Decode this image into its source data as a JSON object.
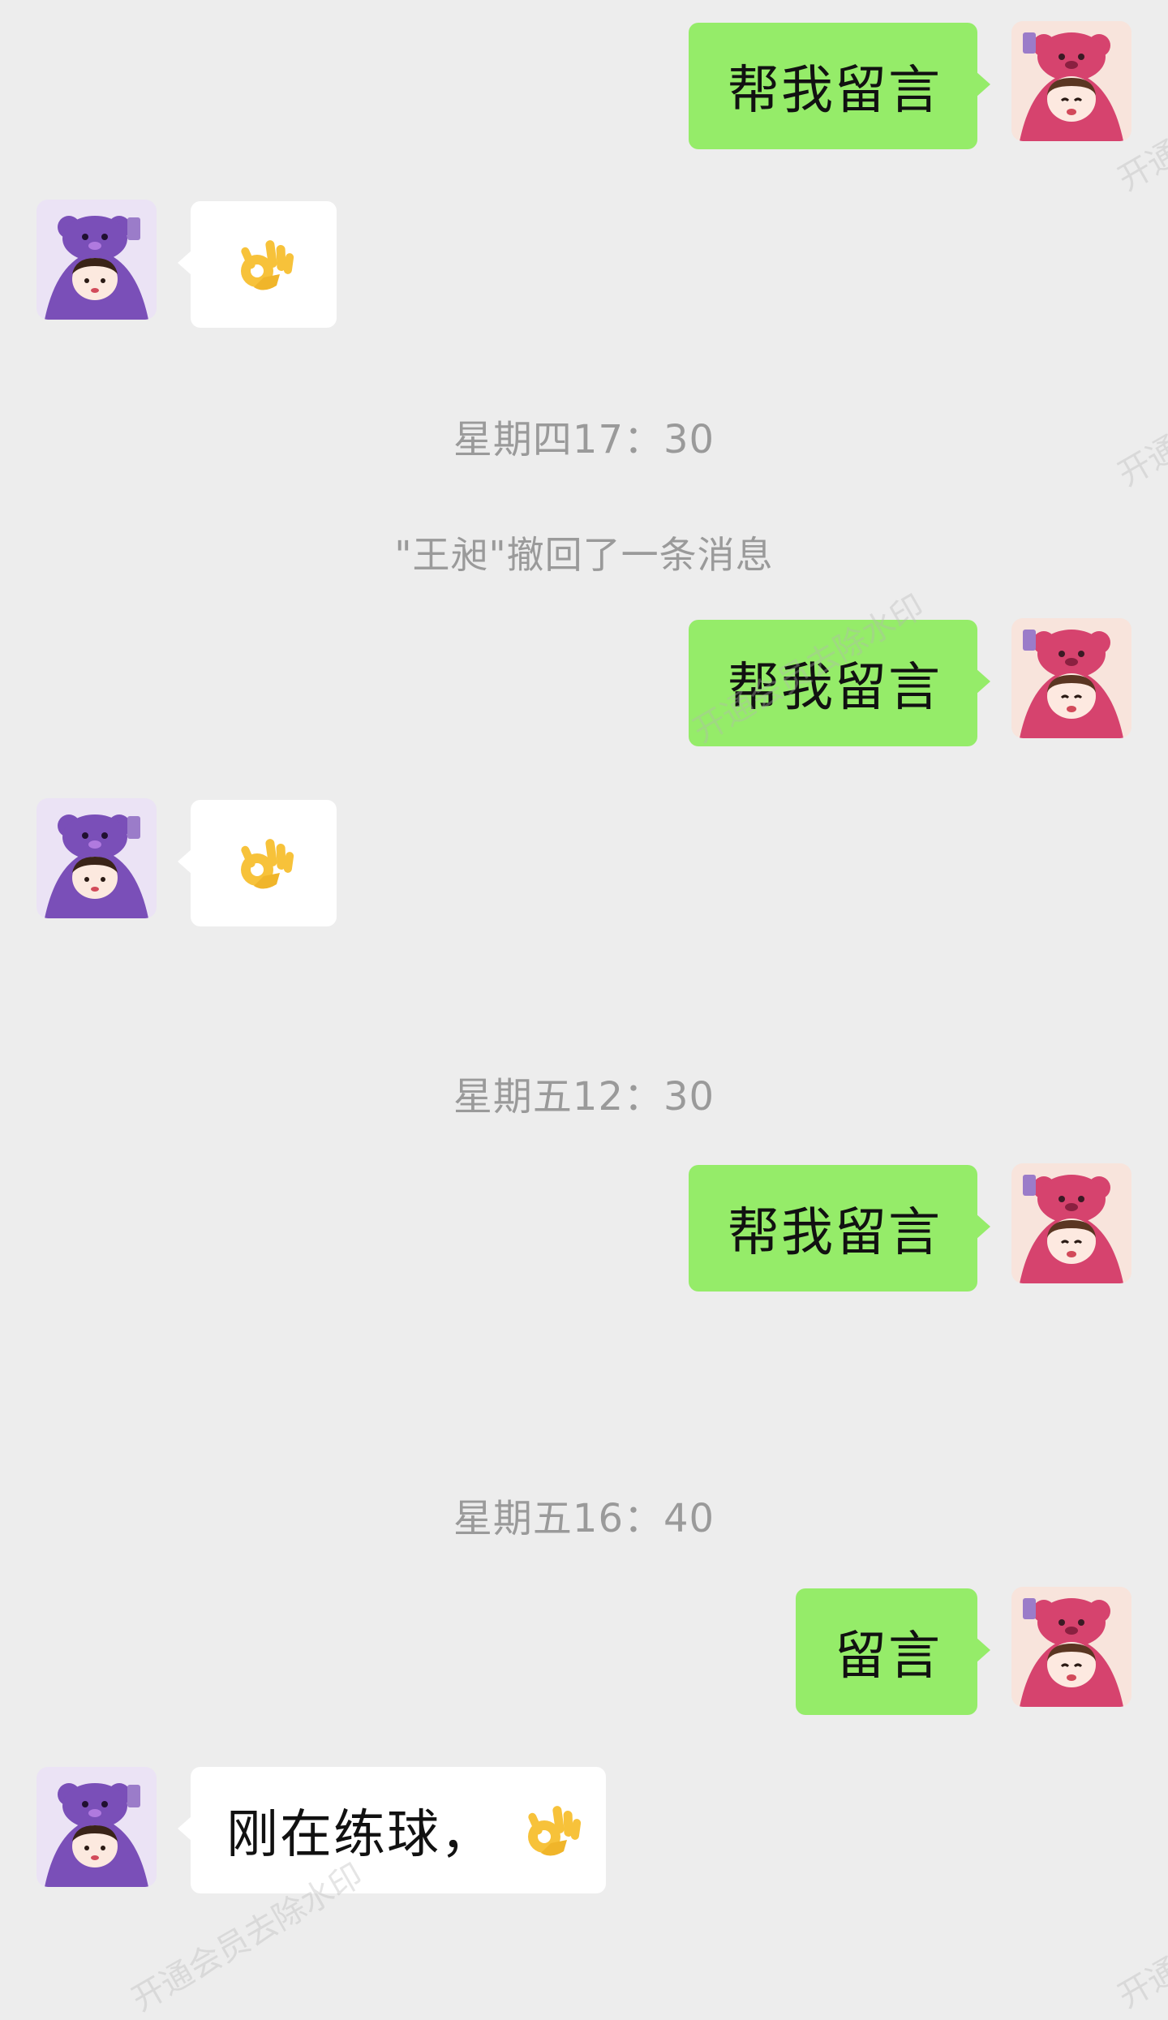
{
  "messages": [
    {
      "type": "outgoing",
      "text": "帮我留言"
    },
    {
      "type": "incoming",
      "icon": "ok-hand-icon"
    },
    {
      "type": "timestamp",
      "text": "星期四17：30"
    },
    {
      "type": "notice",
      "text": "\"王昶\"撤回了一条消息"
    },
    {
      "type": "outgoing",
      "text": "帮我留言"
    },
    {
      "type": "incoming",
      "icon": "ok-hand-icon"
    },
    {
      "type": "timestamp",
      "text": "星期五12：30"
    },
    {
      "type": "outgoing",
      "text": "帮我留言"
    },
    {
      "type": "timestamp",
      "text": "星期五16：40"
    },
    {
      "type": "outgoing",
      "text": "留言"
    },
    {
      "type": "incoming",
      "text": "刚在练球，",
      "icon": "ok-hand-icon"
    }
  ],
  "watermark": {
    "text_full": "开通会员去除水印",
    "text_short": "开通"
  },
  "colors": {
    "background": "#ededed",
    "outgoing_bubble": "#95ec69",
    "incoming_bubble": "#ffffff",
    "timestamp_text": "#9a9a9a"
  }
}
